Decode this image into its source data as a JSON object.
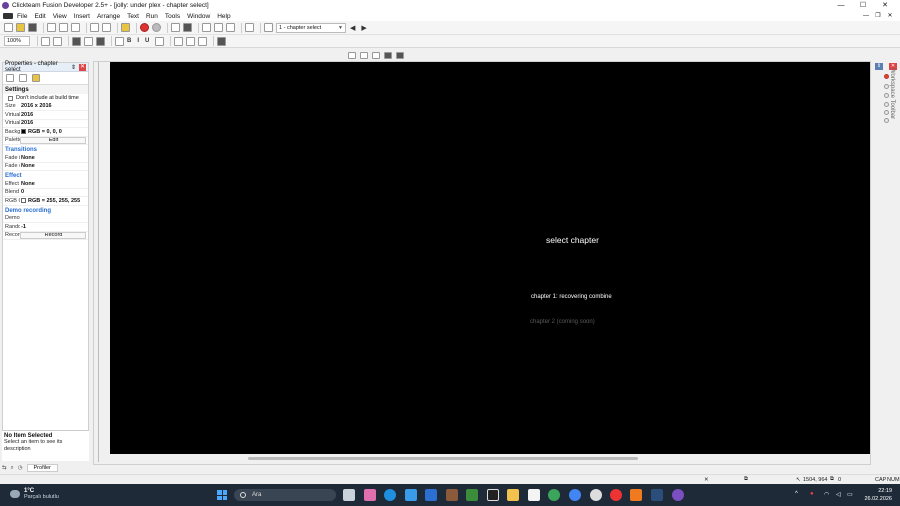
{
  "window": {
    "title": "Clickteam Fusion Developer 2.5+ - [jolly: under plex - chapter select]",
    "controls": [
      "—",
      "☐",
      "✕"
    ]
  },
  "menu": {
    "items": [
      "File",
      "Edit",
      "View",
      "Insert",
      "Arrange",
      "Text",
      "Run",
      "Tools",
      "Window",
      "Help"
    ],
    "mdi_controls": [
      "—",
      "❐",
      "✕"
    ]
  },
  "toolbar": {
    "frame_select": "1 - chapter select",
    "zoom": "100%",
    "prev_arrow": "◀",
    "next_arrow": "▶",
    "format_buttons": [
      "B",
      "I",
      "U"
    ]
  },
  "properties": {
    "title": "Properties - chapter select",
    "pin": "⇕",
    "close": "✕",
    "settings_header": "Settings",
    "dont_include": "Don't include at build time",
    "rows_settings": [
      {
        "key": "Size",
        "value": "2016 x 2016"
      },
      {
        "key": "Virtual",
        "value": "2016"
      },
      {
        "key": "Virtual",
        "value": "2016"
      },
      {
        "key": "Background",
        "value": "RGB = 0, 0, 0",
        "swatch": "#000000"
      },
      {
        "key": "Palette",
        "value": "Edit",
        "button": true
      }
    ],
    "transitions_header": "Transitions",
    "rows_transitions": [
      {
        "key": "Fade in",
        "value": "None"
      },
      {
        "key": "Fade out",
        "value": "None"
      }
    ],
    "effect_header": "Effect",
    "rows_effect": [
      {
        "key": "Effect",
        "value": "None"
      },
      {
        "key": "Blend",
        "value": "0"
      },
      {
        "key": "RGB Coefficient",
        "value": "RGB = 255, 255, 255",
        "swatch": "#ffffff"
      }
    ],
    "demo_header": "Demo recording",
    "rows_demo": [
      {
        "key": "Demo",
        "value": ""
      },
      {
        "key": "Random",
        "value": "-1"
      },
      {
        "key": "Record",
        "value": "Record",
        "button": true
      }
    ],
    "help_title": "No Item Selected",
    "help_text": "Select an item to see its description"
  },
  "bottom_tabs": {
    "profiler": "Profiler"
  },
  "canvas": {
    "background": "#000000",
    "texts": [
      {
        "name": "select-chapter-title",
        "text": "select chapter",
        "color": "#ffffff"
      },
      {
        "name": "chapter-1-label",
        "text": "chapter 1: recovering combine",
        "color": "#ffffff"
      },
      {
        "name": "chapter-2-label",
        "text": "chapter 2 (coming soon)",
        "color": "#5a5a5a"
      }
    ]
  },
  "sidebar": {
    "label": "Workspace Toolbar"
  },
  "status": {
    "coords": "1504, 964",
    "objects": "0",
    "caps": "CAP",
    "num": "NUM"
  },
  "taskbar": {
    "temperature": "1°C",
    "weather": "Parçalı bulutlu",
    "search": "Ara",
    "time": "22:19",
    "date": "26.02.2026"
  }
}
